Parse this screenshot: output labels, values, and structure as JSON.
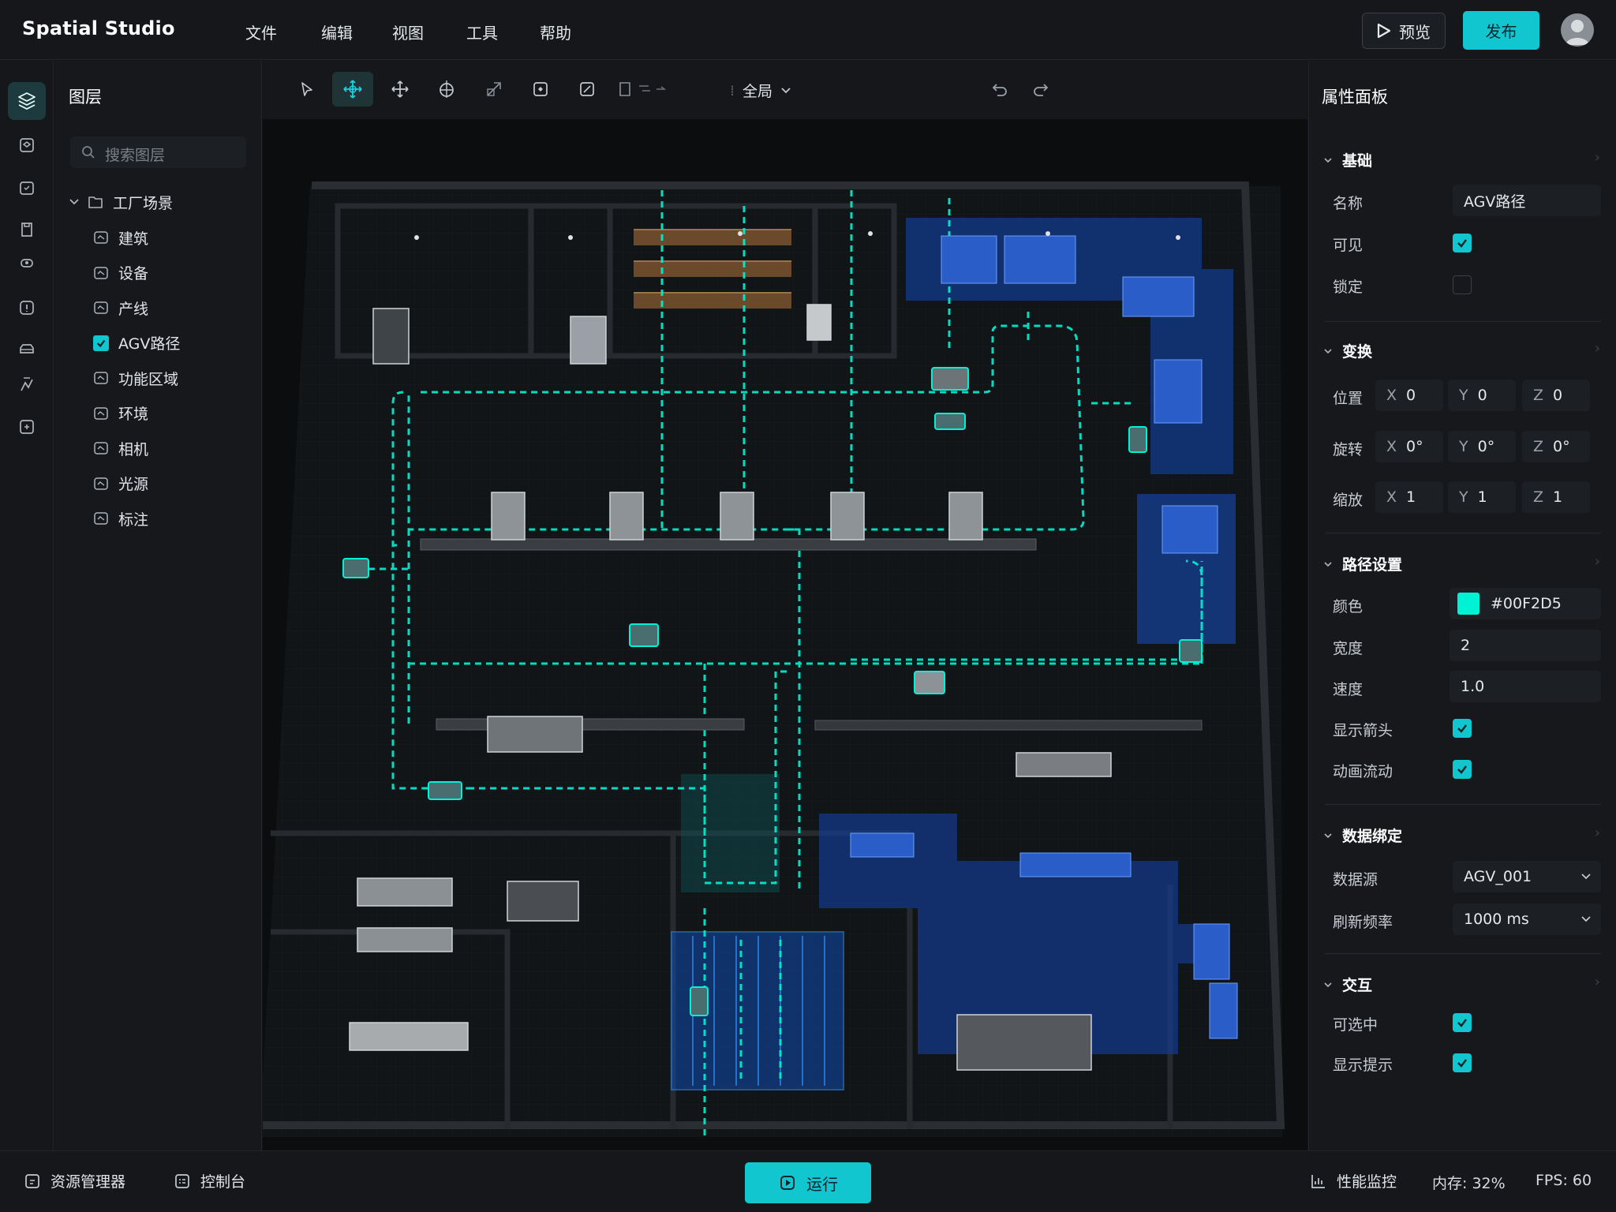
{
  "app": {
    "title": "Spatial Studio"
  },
  "menu": [
    "文件",
    "编辑",
    "视图",
    "工具",
    "帮助"
  ],
  "header": {
    "preview_label": "预览",
    "publish_label": "发布"
  },
  "layers": {
    "title": "图层",
    "search_placeholder": "搜索图层",
    "root": "工厂场景",
    "items": [
      {
        "label": "建筑",
        "checked": false
      },
      {
        "label": "设备",
        "checked": false
      },
      {
        "label": "产线",
        "checked": false
      },
      {
        "label": "AGV路径",
        "checked": true
      },
      {
        "label": "功能区域",
        "checked": false
      },
      {
        "label": "环境",
        "checked": false
      },
      {
        "label": "相机",
        "checked": false
      },
      {
        "label": "光源",
        "checked": false
      },
      {
        "label": "标注",
        "checked": false
      }
    ]
  },
  "viewport": {
    "scope_label": "全局"
  },
  "props": {
    "title": "属性面板",
    "basic": {
      "title": "基础",
      "name_label": "名称",
      "name_value": "AGV路径",
      "visible_label": "可见",
      "visible": true,
      "lock_label": "锁定",
      "locked": false
    },
    "transform": {
      "title": "变换",
      "position_label": "位置",
      "position": {
        "x": "0",
        "y": "0",
        "z": "0"
      },
      "rotation_label": "旋转",
      "rotation": {
        "x": "0°",
        "y": "0°",
        "z": "0°"
      },
      "scale_label": "缩放",
      "scale": {
        "x": "1",
        "y": "1",
        "z": "1"
      },
      "axes": {
        "x": "X",
        "y": "Y",
        "z": "Z"
      }
    },
    "path": {
      "title": "路径设置",
      "color_label": "颜色",
      "color_value": "#00F2D5",
      "width_label": "宽度",
      "width_value": "2",
      "speed_label": "速度",
      "speed_value": "1.0",
      "arrow_label": "显示箭头",
      "arrow": true,
      "flow_label": "动画流动",
      "flow": true
    },
    "binding": {
      "title": "数据绑定",
      "source_label": "数据源",
      "source_value": "AGV_001",
      "refresh_label": "刷新频率",
      "refresh_value": "1000 ms"
    },
    "interaction": {
      "title": "交互",
      "selectable_label": "可选中",
      "selectable": true,
      "tooltip_label": "显示提示",
      "tooltip": true
    }
  },
  "bottom": {
    "assets_label": "资源管理器",
    "console_label": "控制台",
    "run_label": "运行",
    "perf_label": "性能监控",
    "memory": "内存: 32%",
    "fps": "FPS: 60"
  },
  "colors": {
    "accent": "#12c6cf",
    "path": "#00F2D5",
    "zone": "#1a4fb8"
  }
}
